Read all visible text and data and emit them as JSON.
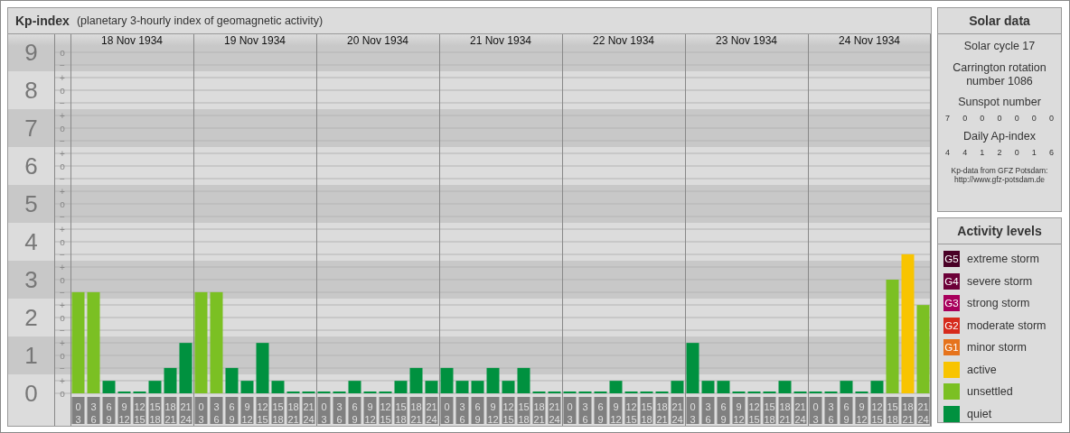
{
  "kp_panel": {
    "title": "Kp-index",
    "subtitle": "(planetary 3-hourly index of geomagnetic activity)",
    "days": [
      {
        "date": "18 Nov 1934"
      },
      {
        "date": "19 Nov 1934"
      },
      {
        "date": "20 Nov 1934"
      },
      {
        "date": "21 Nov 1934"
      },
      {
        "date": "22 Nov 1934"
      },
      {
        "date": "23 Nov 1934"
      },
      {
        "date": "24 Nov 1934"
      }
    ],
    "minor_yticks": [
      "o",
      "−",
      "+",
      "o",
      "−",
      "+",
      "o",
      "−",
      "+",
      "o",
      "−",
      "+",
      "o",
      "−",
      "+",
      "o",
      "−",
      "+",
      "o",
      "−",
      "+",
      "o",
      "−",
      "+",
      "o",
      "−",
      "+",
      "o"
    ],
    "chart_data": {
      "type": "bar",
      "ylim": [
        0,
        9
      ],
      "grid": true,
      "yticks": [
        {
          "value": 0,
          "label": "0"
        },
        {
          "value": 1,
          "label": "1"
        },
        {
          "value": 2,
          "label": "2"
        },
        {
          "value": 3,
          "label": "3"
        },
        {
          "value": 4,
          "label": "4"
        },
        {
          "value": 5,
          "label": "5"
        },
        {
          "value": 6,
          "label": "6"
        },
        {
          "value": 7,
          "label": "7"
        },
        {
          "value": 8,
          "label": "8"
        },
        {
          "value": 9,
          "label": "9"
        }
      ],
      "categories": [
        "0 3",
        "3 6",
        "6 9",
        "9 12",
        "12 15",
        "15 18",
        "18 21",
        "21 24",
        "0 3",
        "3 6",
        "6 9",
        "9 12",
        "12 15",
        "15 18",
        "18 21",
        "21 24",
        "0 3",
        "3 6",
        "6 9",
        "9 12",
        "12 15",
        "15 18",
        "18 21",
        "21 24",
        "0 3",
        "3 6",
        "6 9",
        "9 12",
        "12 15",
        "15 18",
        "18 21",
        "21 24",
        "0 3",
        "3 6",
        "6 9",
        "9 12",
        "12 15",
        "15 18",
        "18 21",
        "21 24",
        "0 3",
        "3 6",
        "6 9",
        "9 12",
        "12 15",
        "15 18",
        "18 21",
        "21 24",
        "0 3",
        "3 6",
        "6 9",
        "9 12",
        "12 15",
        "15 18",
        "18 21",
        "21 24"
      ],
      "series": [
        {
          "name": "active",
          "color": "#f8c400",
          "values": [
            null,
            null,
            null,
            null,
            null,
            null,
            null,
            null,
            null,
            null,
            null,
            null,
            null,
            null,
            null,
            null,
            null,
            null,
            null,
            null,
            null,
            null,
            null,
            null,
            null,
            null,
            null,
            null,
            null,
            null,
            null,
            null,
            null,
            null,
            null,
            null,
            null,
            null,
            null,
            null,
            null,
            null,
            null,
            null,
            null,
            null,
            null,
            null,
            null,
            null,
            null,
            null,
            null,
            null,
            3.67,
            null
          ]
        },
        {
          "name": "unsettled",
          "color": "#7bc023",
          "values": [
            2.67,
            2.67,
            null,
            null,
            null,
            null,
            null,
            null,
            2.67,
            2.67,
            null,
            null,
            null,
            null,
            null,
            null,
            null,
            null,
            null,
            null,
            null,
            null,
            null,
            null,
            null,
            null,
            null,
            null,
            null,
            null,
            null,
            null,
            null,
            null,
            null,
            null,
            null,
            null,
            null,
            null,
            null,
            null,
            null,
            null,
            null,
            null,
            null,
            null,
            null,
            null,
            null,
            null,
            null,
            3,
            null,
            2.33
          ]
        },
        {
          "name": "quiet",
          "color": "#00913f",
          "values": [
            null,
            null,
            0.33,
            0,
            0,
            0.33,
            0.67,
            1.33,
            null,
            null,
            0.67,
            0.33,
            1.33,
            0.33,
            0,
            0,
            0,
            0,
            0.33,
            0,
            0,
            0.33,
            0.67,
            0.33,
            0.67,
            0.33,
            0.33,
            0.67,
            0.33,
            0.67,
            0,
            0,
            0,
            0,
            0,
            0.33,
            0,
            0,
            0,
            0.33,
            1.33,
            0.33,
            0.33,
            0,
            0,
            0,
            0.33,
            0,
            0,
            0,
            0.33,
            0,
            0.33,
            null,
            null,
            null
          ]
        }
      ]
    }
  },
  "solar_data": {
    "title": "Solar data",
    "cycle": "Solar cycle 17",
    "rotation": "Carrington rotation number 1086",
    "sunspot_label": "Sunspot number",
    "sunspot_values": [
      "7",
      "0",
      "0",
      "0",
      "0",
      "0",
      "0"
    ],
    "ap_label": "Daily Ap-index",
    "ap_values": [
      "4",
      "4",
      "1",
      "2",
      "0",
      "1",
      "6"
    ],
    "source_lines": [
      "Kp-data from GFZ Potsdam:",
      "http://www.gfz-potsdam.de"
    ]
  },
  "activity_levels": {
    "title": "Activity levels",
    "items": [
      {
        "badge": "G5",
        "label": "extreme storm",
        "color": "#4a0026"
      },
      {
        "badge": "G4",
        "label": "severe storm",
        "color": "#6c0038"
      },
      {
        "badge": "G3",
        "label": "strong storm",
        "color": "#a8005c"
      },
      {
        "badge": "G2",
        "label": "moderate storm",
        "color": "#d62a1c"
      },
      {
        "badge": "G1",
        "label": "minor storm",
        "color": "#e6731c"
      }
    ]
  }
}
